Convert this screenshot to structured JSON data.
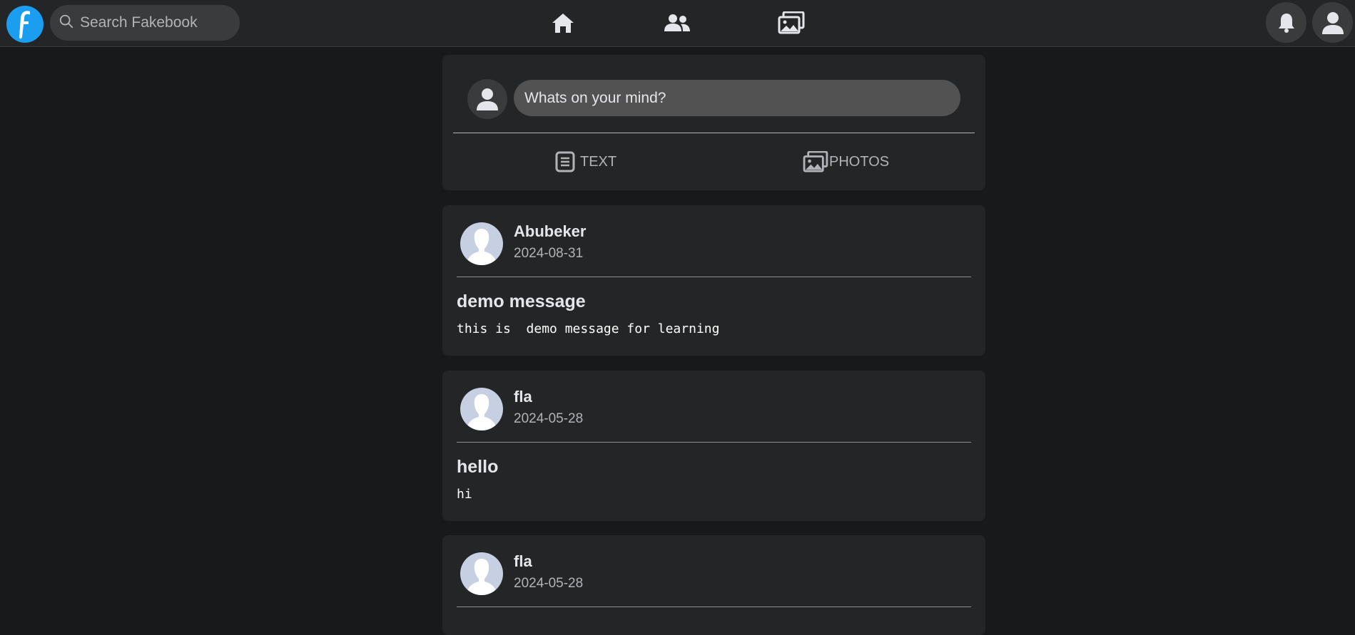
{
  "header": {
    "logo_letter": "f",
    "search_placeholder": "Search Fakebook",
    "nav_icons": [
      "home-icon",
      "friends-icon",
      "photos-icon"
    ],
    "right_icons": [
      "bell-icon",
      "user-icon"
    ],
    "brand_color": "#1b9df0"
  },
  "composer": {
    "placeholder": "Whats on your mind?",
    "actions": [
      {
        "label": "TEXT",
        "icon": "text-note-icon"
      },
      {
        "label": "PHOTOS",
        "icon": "photos-icon"
      }
    ]
  },
  "posts": [
    {
      "author": "Abubeker",
      "date": "2024-08-31",
      "title": "demo message",
      "body": "this is  demo message for learning"
    },
    {
      "author": "fla",
      "date": "2024-05-28",
      "title": "hello",
      "body": "hi"
    },
    {
      "author": "fla",
      "date": "2024-05-28",
      "title": "",
      "body": ""
    }
  ]
}
